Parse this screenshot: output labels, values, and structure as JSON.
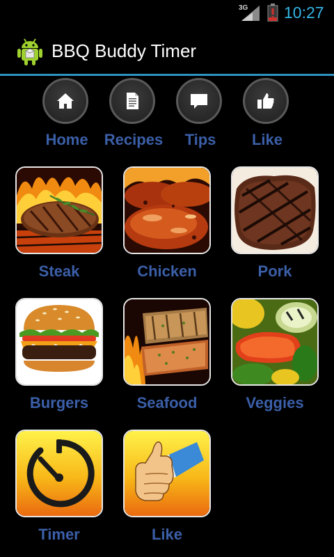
{
  "status_bar": {
    "network": "3G",
    "time": "10:27"
  },
  "action_bar": {
    "title": "BBQ Buddy Timer",
    "logo_icon": "android-robot-icon"
  },
  "nav": {
    "items": [
      {
        "label": "Home",
        "icon": "home-icon"
      },
      {
        "label": "Recipes",
        "icon": "document-icon"
      },
      {
        "label": "Tips",
        "icon": "chat-bubble-icon"
      },
      {
        "label": "Like",
        "icon": "thumbs-up-icon"
      }
    ]
  },
  "grid": {
    "tiles": [
      {
        "label": "Steak",
        "image": "steak-on-grill"
      },
      {
        "label": "Chicken",
        "image": "bbq-chicken"
      },
      {
        "label": "Pork",
        "image": "grilled-pork"
      },
      {
        "label": "Burgers",
        "image": "burger"
      },
      {
        "label": "Seafood",
        "image": "grilled-fish"
      },
      {
        "label": "Veggies",
        "image": "grilled-vegetables"
      },
      {
        "label": "Timer",
        "image": "timer-icon"
      },
      {
        "label": "Like",
        "image": "thumbs-up-icon"
      }
    ]
  },
  "colors": {
    "accent": "#35b5e5",
    "label_blue": "#3b5fa8",
    "divider": "#2f93c2",
    "background": "#000000"
  }
}
